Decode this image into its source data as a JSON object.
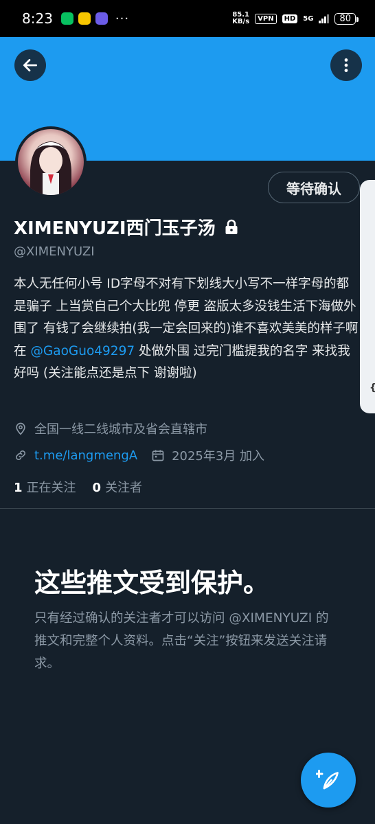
{
  "status_bar": {
    "time": "8:23",
    "overflow": "···",
    "net_speed_value": "85.1",
    "net_speed_unit": "KB/s",
    "vpn": "VPN",
    "hd": "HD",
    "signal": "5G",
    "battery": "80"
  },
  "header": {
    "back_icon": "arrow-left-icon",
    "more_icon": "vertical-dots-icon"
  },
  "profile": {
    "display_name": "XIMENYUZI西门玉子汤",
    "handle": "@XIMENYUZI",
    "pending_button": "等待确认",
    "bio_before": "本人无任何小号 ID字母不对有下划线大小写不一样字母的都是骗子 上当赏自己个大比兜 停更 盗版太多没钱生活下海做外围了 有钱了会继续拍(我一定会回来的)谁不喜欢美美的样子啊 在 ",
    "bio_mention": "@GaoGuo49297",
    "bio_after": " 处做外围 过完门槛提我的名字 来找我好吗 (关注能点还是点下 谢谢啦)",
    "location": "全国一线二线城市及省会直辖市",
    "link": "t.me/langmengA",
    "joined": "2025年3月 加入",
    "following_count": "1",
    "following_label": "正在关注",
    "followers_count": "0",
    "followers_label": "关注者"
  },
  "protected": {
    "title": "这些推文受到保护。",
    "description": "只有经过确认的关注者才可以访问 @XIMENYUZI 的推文和完整个人资料。点击“关注”按钮来发送关注请求。"
  },
  "side_tab": {
    "glyph": "{"
  },
  "colors": {
    "background": "#15202b",
    "banner": "#1d9bf0",
    "accent": "#1d9bf0",
    "muted": "#8b98a5"
  }
}
